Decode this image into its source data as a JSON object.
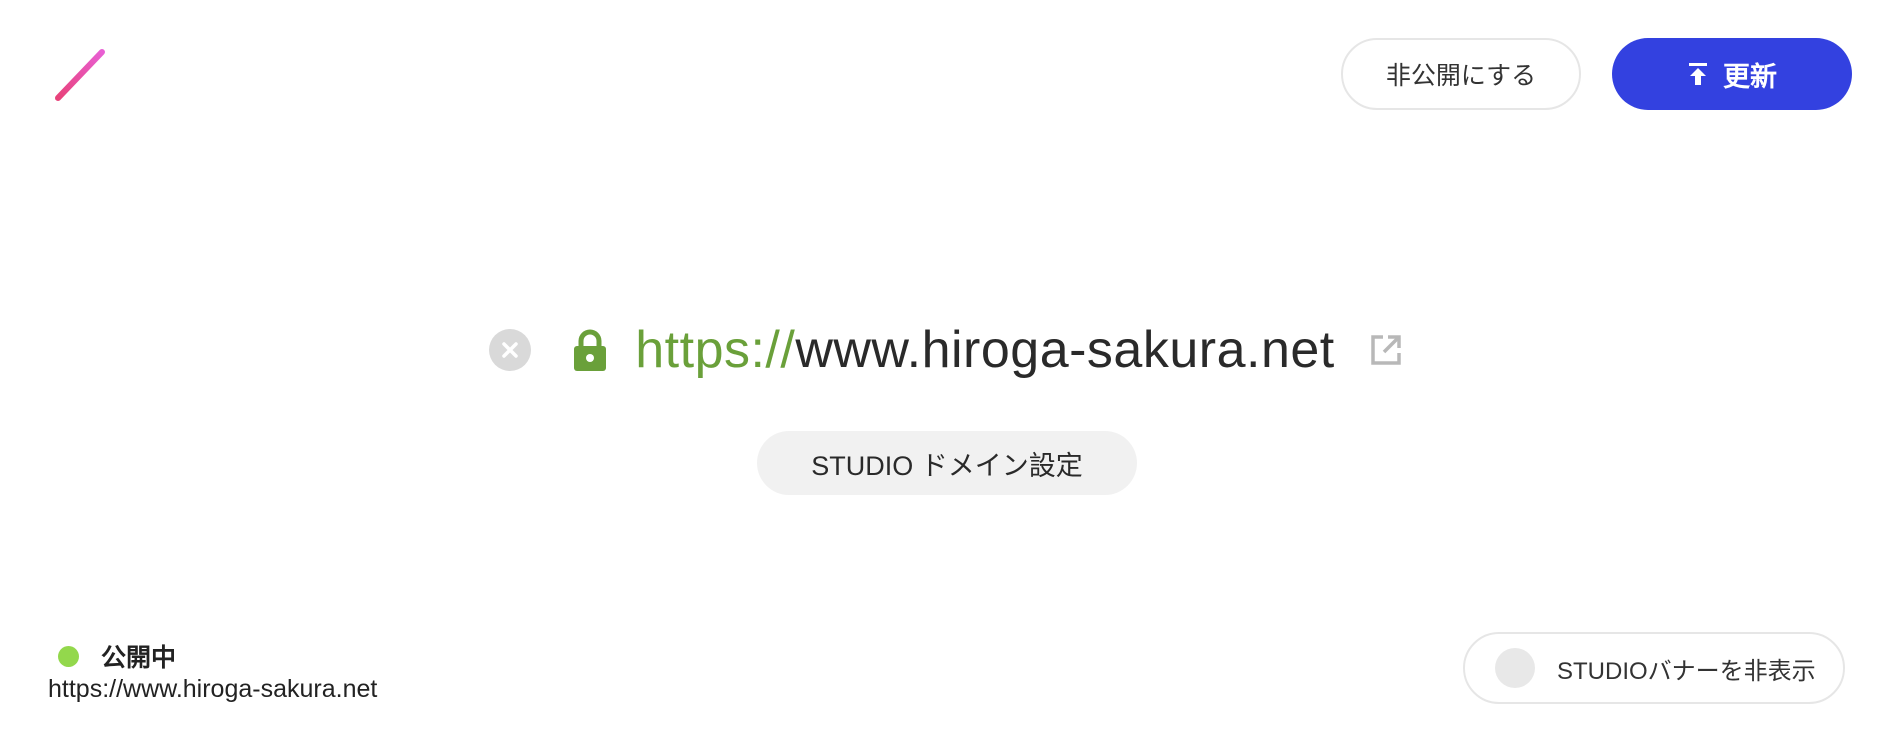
{
  "header": {
    "logo_icon": "pencil-slash-logo",
    "unpublish_label": "非公開にする",
    "update_label": "更新",
    "update_icon": "upload-arrow-icon",
    "accent_color": "#3341e0"
  },
  "domain": {
    "clear_icon": "close-circle-icon",
    "lock_icon": "lock-icon",
    "protocol": "https://",
    "host": "www.hiroga-sakura.net",
    "external_icon": "external-link-icon",
    "protocol_color": "#6aa03a",
    "settings_label": "STUDIO ドメイン設定"
  },
  "status": {
    "label": "公開中",
    "dot_color": "#93d84c",
    "url": "https://www.hiroga-sakura.net"
  },
  "banner": {
    "label": "STUDIOバナーを非表示",
    "enabled": false
  }
}
